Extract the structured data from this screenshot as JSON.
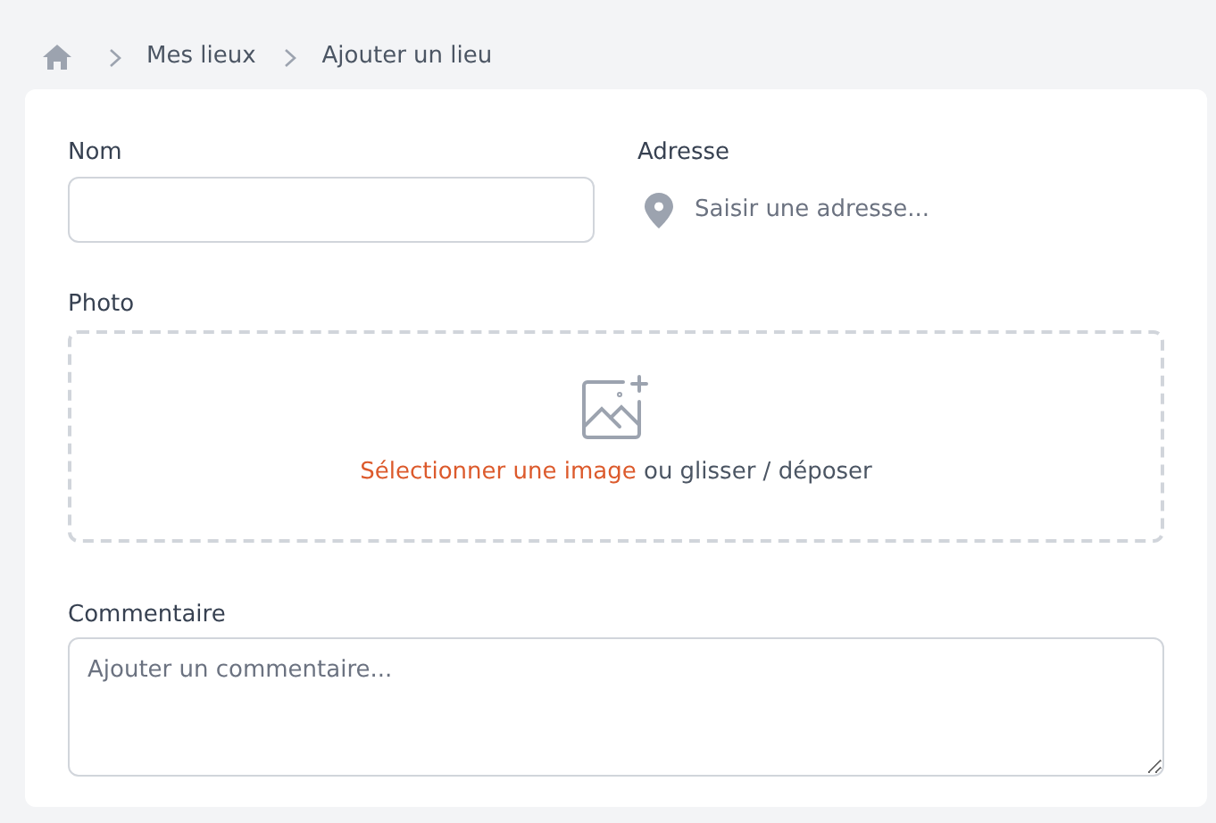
{
  "breadcrumb": [
    "Mes lieux",
    "Ajouter un lieu"
  ],
  "form": {
    "name": {
      "label": "Nom"
    },
    "address": {
      "label": "Adresse",
      "placeholder": "Saisir une adresse..."
    },
    "photo": {
      "label": "Photo",
      "link": "Sélectionner une image",
      "hint": "ou glisser / déposer"
    },
    "comment": {
      "label": "Commentaire",
      "placeholder": "Ajouter un commentaire..."
    }
  }
}
